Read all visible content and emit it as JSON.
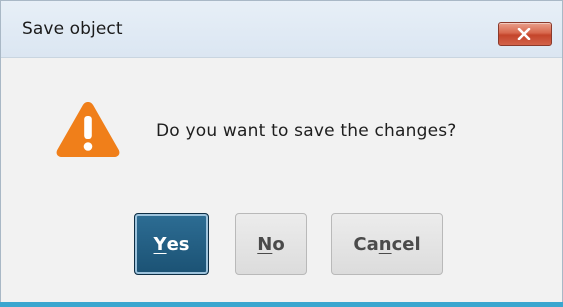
{
  "dialog": {
    "title": "Save object",
    "close_icon": "close-x-icon",
    "message": "Do you want to save the changes?",
    "icon": "warning-icon",
    "colors": {
      "warning": "#f07f1a",
      "close_button": "#d2634a",
      "default_button": "#1b5274"
    }
  },
  "buttons": {
    "yes": {
      "mnemonic": "Y",
      "rest": "es"
    },
    "no": {
      "mnemonic": "N",
      "rest": "o"
    },
    "cancel": {
      "pre": "Ca",
      "mnemonic": "n",
      "rest": "cel"
    }
  }
}
